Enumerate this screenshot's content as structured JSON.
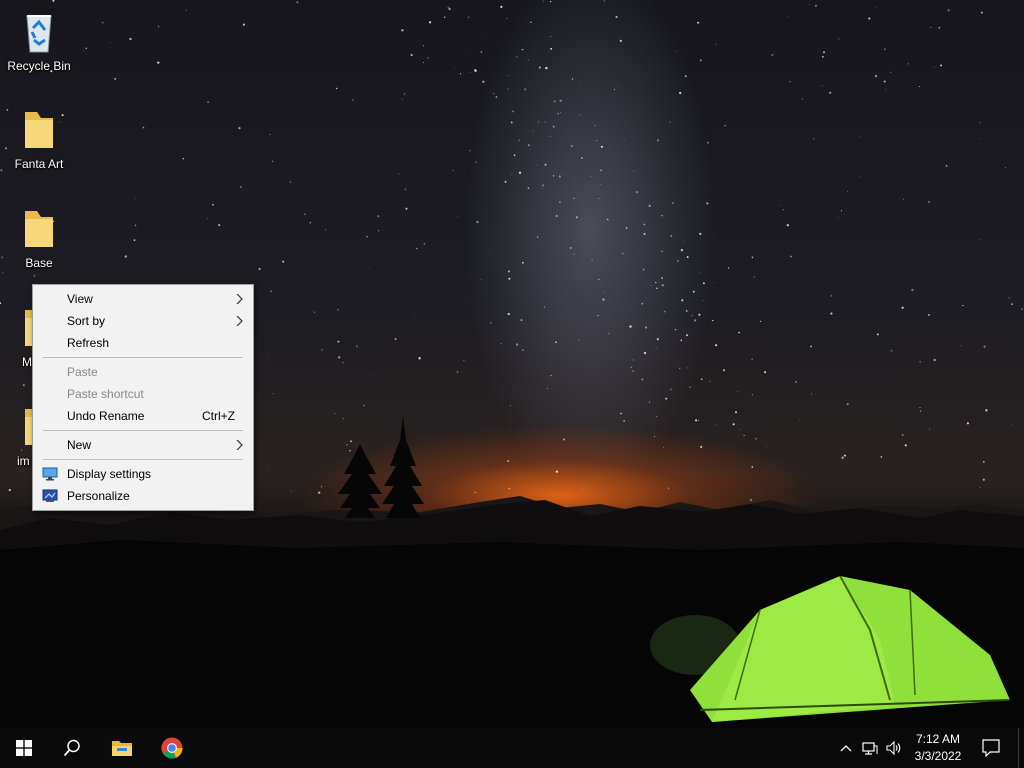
{
  "desktop": {
    "icons": [
      {
        "label": "Recycle Bin",
        "icon": "recycle-bin-icon"
      },
      {
        "label": "Fanta Art",
        "icon": "folder-icon"
      },
      {
        "label": "Base",
        "icon": "folder-icon"
      },
      {
        "label": "M",
        "icon": "folder-icon"
      },
      {
        "label": "im",
        "icon": "folder-icon"
      }
    ]
  },
  "context_menu": {
    "view": "View",
    "sort_by": "Sort by",
    "refresh": "Refresh",
    "paste": "Paste",
    "paste_shortcut": "Paste shortcut",
    "undo_rename": "Undo Rename",
    "undo_rename_shortcut": "Ctrl+Z",
    "new": "New",
    "display_settings": "Display settings",
    "personalize": "Personalize"
  },
  "taskbar": {
    "pinned": [
      "start-icon",
      "search-icon",
      "file-explorer-icon",
      "chrome-icon"
    ],
    "tray": [
      "chevron-up-icon",
      "network-icon",
      "volume-icon"
    ],
    "time": "7:12 AM",
    "date": "3/3/2022"
  },
  "colors": {
    "taskbar": "#0a0a0a",
    "menu_bg": "#f2f2f2",
    "folder": "#f3cf6c",
    "tent": "#8fe03a"
  }
}
